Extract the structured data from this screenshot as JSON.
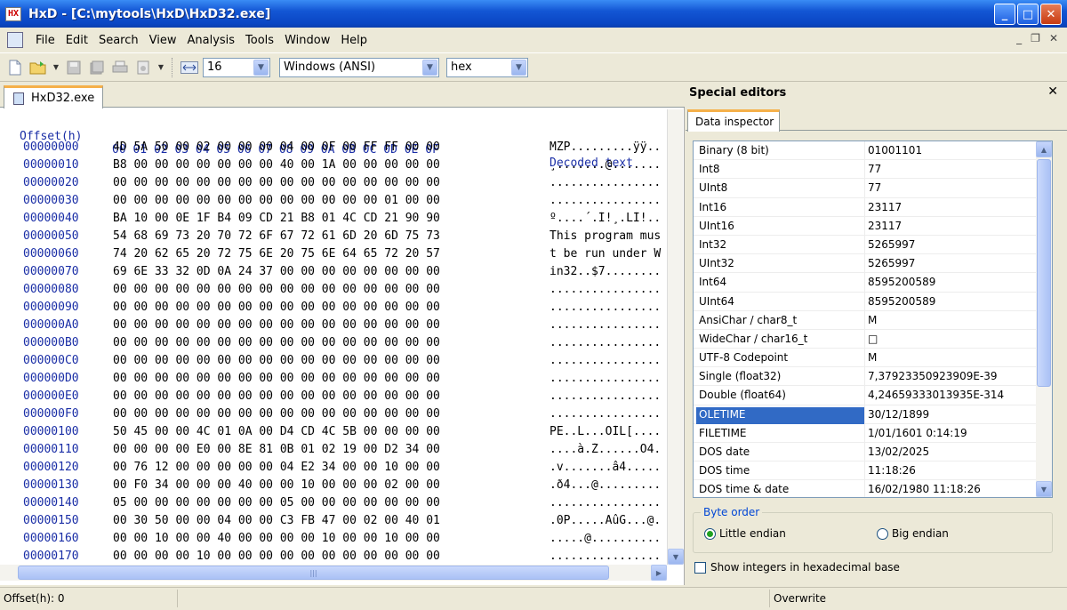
{
  "window": {
    "title": "HxD - [C:\\mytools\\HxD\\HxD32.exe]",
    "app_icon_text": "HX",
    "minimize": "_",
    "maximize": "□",
    "close": "✕"
  },
  "menu": {
    "items": [
      "File",
      "Edit",
      "Search",
      "View",
      "Analysis",
      "Tools",
      "Window",
      "Help"
    ],
    "mdi_minimize": "_",
    "mdi_restore": "❐",
    "mdi_close": "✕"
  },
  "toolbar": {
    "bytes_per_row": "16",
    "encoding": "Windows (ANSI)",
    "offset_base": "hex",
    "dropdown_glyph": "▼"
  },
  "editor": {
    "tab_label": "HxD32.exe",
    "header_offset": "Offset(h)",
    "header_columns": "00 01 02 03 04 05 06 07 08 09 0A 0B 0C 0D 0E 0F",
    "header_decoded": "Decoded text",
    "rows": [
      {
        "offset": "00000000",
        "bytes": "4D 5A 50 00 02 00 00 00 04 00 0F 00 FF FF 00 00",
        "text": "MZP.........ÿÿ.."
      },
      {
        "offset": "00000010",
        "bytes": "B8 00 00 00 00 00 00 00 40 00 1A 00 00 00 00 00",
        "text": "¸.......@......."
      },
      {
        "offset": "00000020",
        "bytes": "00 00 00 00 00 00 00 00 00 00 00 00 00 00 00 00",
        "text": "................"
      },
      {
        "offset": "00000030",
        "bytes": "00 00 00 00 00 00 00 00 00 00 00 00 00 01 00 00",
        "text": "................"
      },
      {
        "offset": "00000040",
        "bytes": "BA 10 00 0E 1F B4 09 CD 21 B8 01 4C CD 21 90 90",
        "text": "º....´.Í!¸.LÍ!.."
      },
      {
        "offset": "00000050",
        "bytes": "54 68 69 73 20 70 72 6F 67 72 61 6D 20 6D 75 73",
        "text": "This program mus"
      },
      {
        "offset": "00000060",
        "bytes": "74 20 62 65 20 72 75 6E 20 75 6E 64 65 72 20 57",
        "text": "t be run under W"
      },
      {
        "offset": "00000070",
        "bytes": "69 6E 33 32 0D 0A 24 37 00 00 00 00 00 00 00 00",
        "text": "in32..$7........"
      },
      {
        "offset": "00000080",
        "bytes": "00 00 00 00 00 00 00 00 00 00 00 00 00 00 00 00",
        "text": "................"
      },
      {
        "offset": "00000090",
        "bytes": "00 00 00 00 00 00 00 00 00 00 00 00 00 00 00 00",
        "text": "................"
      },
      {
        "offset": "000000A0",
        "bytes": "00 00 00 00 00 00 00 00 00 00 00 00 00 00 00 00",
        "text": "................"
      },
      {
        "offset": "000000B0",
        "bytes": "00 00 00 00 00 00 00 00 00 00 00 00 00 00 00 00",
        "text": "................"
      },
      {
        "offset": "000000C0",
        "bytes": "00 00 00 00 00 00 00 00 00 00 00 00 00 00 00 00",
        "text": "................"
      },
      {
        "offset": "000000D0",
        "bytes": "00 00 00 00 00 00 00 00 00 00 00 00 00 00 00 00",
        "text": "................"
      },
      {
        "offset": "000000E0",
        "bytes": "00 00 00 00 00 00 00 00 00 00 00 00 00 00 00 00",
        "text": "................"
      },
      {
        "offset": "000000F0",
        "bytes": "00 00 00 00 00 00 00 00 00 00 00 00 00 00 00 00",
        "text": "................"
      },
      {
        "offset": "00000100",
        "bytes": "50 45 00 00 4C 01 0A 00 D4 CD 4C 5B 00 00 00 00",
        "text": "PE..L...ÔÍL[...."
      },
      {
        "offset": "00000110",
        "bytes": "00 00 00 00 E0 00 8E 81 0B 01 02 19 00 D2 34 00",
        "text": "....à.Ž......Ò4."
      },
      {
        "offset": "00000120",
        "bytes": "00 76 12 00 00 00 00 00 04 E2 34 00 00 10 00 00",
        "text": ".v.......â4....."
      },
      {
        "offset": "00000130",
        "bytes": "00 F0 34 00 00 00 40 00 00 10 00 00 00 02 00 00",
        "text": ".ð4...@........."
      },
      {
        "offset": "00000140",
        "bytes": "05 00 00 00 00 00 00 00 05 00 00 00 00 00 00 00",
        "text": "................"
      },
      {
        "offset": "00000150",
        "bytes": "00 30 50 00 00 04 00 00 C3 FB 47 00 02 00 40 01",
        "text": ".0P.....ÃûG...@."
      },
      {
        "offset": "00000160",
        "bytes": "00 00 10 00 00 40 00 00 00 00 10 00 00 10 00 00",
        "text": ".....@.........."
      },
      {
        "offset": "00000170",
        "bytes": "00 00 00 00 10 00 00 00 00 00 00 00 00 00 00 00",
        "text": "................"
      }
    ],
    "scroll_down_glyph": "▼",
    "scroll_right_glyph": "▶",
    "grip_glyph": "|||"
  },
  "special_editors": {
    "title": "Special editors",
    "close_glyph": "✕",
    "tab_label": "Data inspector",
    "inspector_rows": [
      {
        "name": "Binary (8 bit)",
        "value": "01001101"
      },
      {
        "name": "Int8",
        "value": "77"
      },
      {
        "name": "UInt8",
        "value": "77"
      },
      {
        "name": "Int16",
        "value": "23117"
      },
      {
        "name": "UInt16",
        "value": "23117"
      },
      {
        "name": "Int32",
        "value": "5265997"
      },
      {
        "name": "UInt32",
        "value": "5265997"
      },
      {
        "name": "Int64",
        "value": "8595200589"
      },
      {
        "name": "UInt64",
        "value": "8595200589"
      },
      {
        "name": "AnsiChar / char8_t",
        "value": "M"
      },
      {
        "name": "WideChar / char16_t",
        "value": "□"
      },
      {
        "name": "UTF-8 Codepoint",
        "value": "M"
      },
      {
        "name": "Single (float32)",
        "value": "7,37923350923909E-39"
      },
      {
        "name": "Double (float64)",
        "value": "4,24659333013935E-314"
      },
      {
        "name": "OLETIME",
        "value": "30/12/1899",
        "selected": true
      },
      {
        "name": "FILETIME",
        "value": "1/01/1601 0:14:19"
      },
      {
        "name": "DOS date",
        "value": "13/02/2025"
      },
      {
        "name": "DOS time",
        "value": "11:18:26"
      },
      {
        "name": "DOS time & date",
        "value": "16/02/1980 11:18:26"
      }
    ],
    "scroll_up_glyph": "▲",
    "scroll_down_glyph": "▼",
    "byte_order_label": "Byte order",
    "little_endian": "Little endian",
    "big_endian": "Big endian",
    "little_endian_selected": true,
    "hex_ints_label": "Show integers in hexadecimal base",
    "hex_ints_checked": false
  },
  "status": {
    "offset": "Offset(h): 0",
    "mode": "Overwrite"
  },
  "colors": {
    "offset_blue": "#1a2ea6",
    "selection": "#316ac5",
    "tab_accent": "#f5b04a"
  }
}
